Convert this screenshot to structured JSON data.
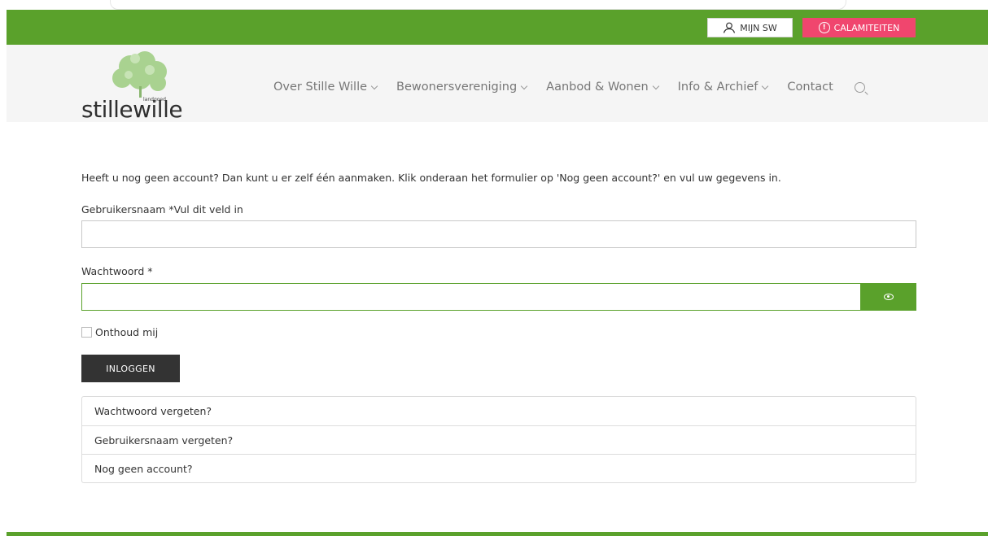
{
  "topbar": {
    "mijn_label": "MIJN SW",
    "calamiteiten_label": "CALAMITEITEN",
    "cal_icon_glyph": "!"
  },
  "logo": {
    "word": "stillewille",
    "small": "landgoed"
  },
  "nav": {
    "items": [
      {
        "label": "Over Stille Wille"
      },
      {
        "label": "Bewonersvereniging"
      },
      {
        "label": "Aanbod & Wonen"
      },
      {
        "label": "Info & Archief"
      },
      {
        "label": "Contact"
      }
    ]
  },
  "form": {
    "intro": "Heeft u nog geen account? Dan kunt u er zelf één aanmaken. Klik onderaan het formulier op 'Nog geen account?' en vul uw gegevens in.",
    "username_label": "Gebruikersnaam *Vul dit veld in",
    "username_value": "",
    "password_label": "Wachtwoord *",
    "password_value": "",
    "remember_label": "Onthoud mij",
    "login_label": "INLOGGEN"
  },
  "links": {
    "items": [
      {
        "label": "Wachtwoord vergeten?"
      },
      {
        "label": "Gebruikersnaam vergeten?"
      },
      {
        "label": "Nog geen account?"
      }
    ]
  },
  "colors": {
    "brand_green": "#5aa12b",
    "alert_pink": "#f0466e",
    "dark_button": "#333333"
  }
}
